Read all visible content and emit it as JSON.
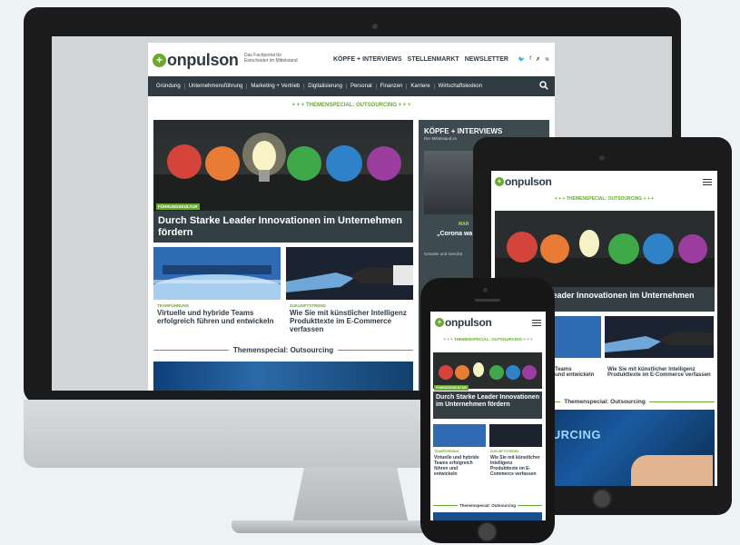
{
  "brand": {
    "name": "onpulson",
    "tagline_1": "Das Fachportal für",
    "tagline_2": "Entscheider im Mittelstand",
    "accent": "#6aa832",
    "nav_bg": "#2f3b40"
  },
  "top_nav": [
    "KÖPFE + INTERVIEWS",
    "STELLENMARKT",
    "NEWSLETTER"
  ],
  "social_icons": [
    "twitter-icon",
    "facebook-icon",
    "xing-icon",
    "rss-icon"
  ],
  "main_nav": [
    "Gründung",
    "Unternehmensführung",
    "Marketing + Vertrieb",
    "Digitalisierung",
    "Personal",
    "Finanzen",
    "Karriere",
    "Wirtschaftslexikon"
  ],
  "special_banner": "+ + + THEMENSPECIAL: OUTSOURCING + + +",
  "feature": {
    "category": "FÜHRUNGSKULTUR",
    "title_desktop": "Durch Starke Leader Innovationen im Unternehmen fördern",
    "title_tablet": "Leader Innovationen im Unternehmen"
  },
  "cards": [
    {
      "category": "TEAMFÜHRUNG",
      "title": "Virtuelle und hybride Teams erfolgreich führen und entwickeln"
    },
    {
      "category": "ZUKUNFTSTREND",
      "title": "Wie Sie mit künstlicher Intelligenz Produkttexte im E-Commerce verfassen"
    }
  ],
  "section_heading": "Themenspecial: Outsourcing",
  "sidebar": {
    "heading": "KÖPFE + INTERVIEWS",
    "subheading": "Der Mittelstand im",
    "name": "MAR",
    "quote_1": "„Corona wa",
    "quote_2": "U",
    "footer": "Gründer und Geschä"
  },
  "tablet": {
    "card_left": "Teams\nund entwickeln",
    "card_right": "Wie Sie mit künstlicher Intelligenz Produkttexte im E-Commerce verfassen",
    "outsourcing_label": "OUTSOURCING"
  },
  "phone": {
    "special": "+ + + THEMENSPECIAL: OUTSOURCING + + +",
    "card_left_title": "Virtuelle und hybride Teams erfolgreich führen und entwickeln",
    "card_right_title": "Wie Sie mit künstlicher Intelligenz Produkttexte im E-Commerce verfassen"
  }
}
